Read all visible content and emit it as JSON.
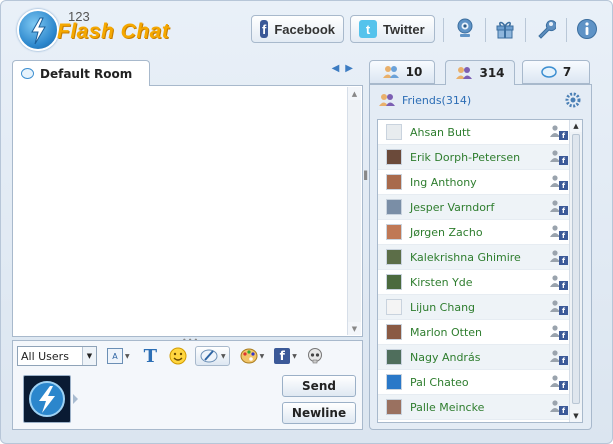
{
  "app": {
    "logo_sup": "123",
    "logo_text": "Flash Chat"
  },
  "header": {
    "facebook_label": "Facebook",
    "twitter_label": "Twitter",
    "icons": [
      "webcam-icon",
      "gift-icon",
      "wrench-icon",
      "info-icon"
    ]
  },
  "room": {
    "tab_label": "Default Room",
    "prev_arrow": "◀",
    "next_arrow": "▶"
  },
  "input": {
    "user_filter": "All Users",
    "send_label": "Send",
    "newline_label": "Newline"
  },
  "users_tabs": [
    {
      "count": "10",
      "icon": "users-icon"
    },
    {
      "count": "314",
      "icon": "friends-icon",
      "active": true
    },
    {
      "count": "7",
      "icon": "chat-bubble-icon"
    }
  ],
  "friends": {
    "header": "Friends(314)",
    "list": [
      {
        "name": "Ahsan Butt",
        "pic": "#e8ecef"
      },
      {
        "name": "Erik Dorph-Petersen",
        "pic": "#6b4a3a"
      },
      {
        "name": "Ing Anthony",
        "pic": "#a86a4c"
      },
      {
        "name": "Jesper Varndorf",
        "pic": "#7a8ea6"
      },
      {
        "name": "Jørgen Zacho",
        "pic": "#c07855"
      },
      {
        "name": "Kalekrishna Ghimire",
        "pic": "#5c6e48"
      },
      {
        "name": "Kirsten Yde",
        "pic": "#4b6a3e"
      },
      {
        "name": "Lijun Chang",
        "pic": "#f4f4f4"
      },
      {
        "name": "Marlon Otten",
        "pic": "#8a5a44"
      },
      {
        "name": "Nagy András",
        "pic": "#4f6e5c"
      },
      {
        "name": "Pal Chateo",
        "pic": "#2a78c8"
      },
      {
        "name": "Palle Meincke",
        "pic": "#9a7160"
      }
    ]
  }
}
